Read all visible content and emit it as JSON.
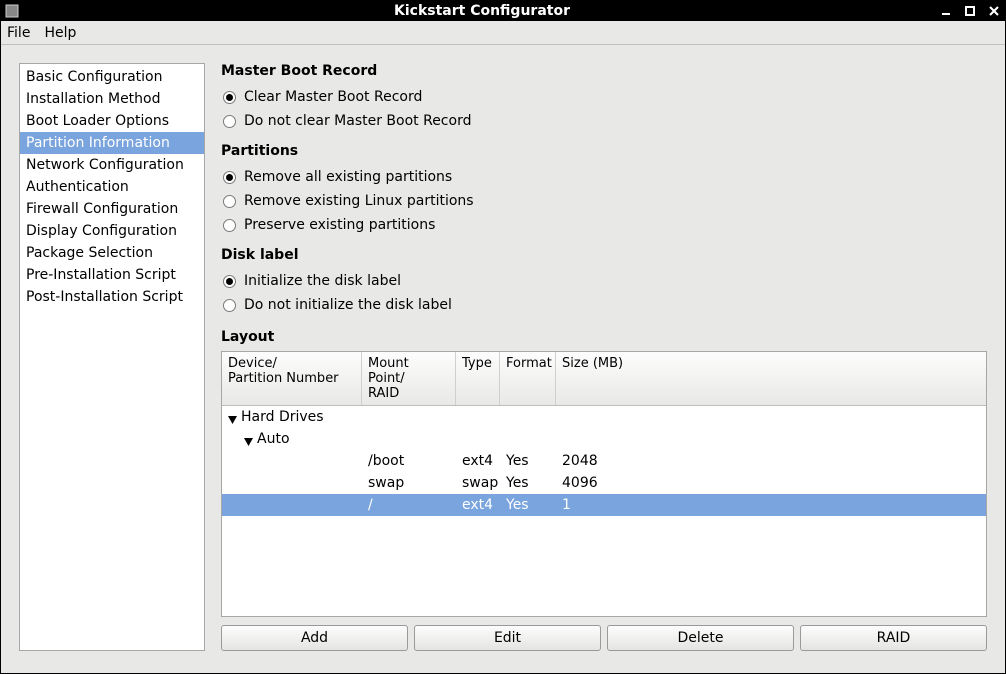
{
  "window": {
    "title": "Kickstart Configurator"
  },
  "menubar": {
    "file": "File",
    "help": "Help"
  },
  "sidebar": {
    "items": [
      {
        "label": "Basic Configuration",
        "selected": false
      },
      {
        "label": "Installation Method",
        "selected": false
      },
      {
        "label": "Boot Loader Options",
        "selected": false
      },
      {
        "label": "Partition Information",
        "selected": true
      },
      {
        "label": "Network Configuration",
        "selected": false
      },
      {
        "label": "Authentication",
        "selected": false
      },
      {
        "label": "Firewall Configuration",
        "selected": false
      },
      {
        "label": "Display Configuration",
        "selected": false
      },
      {
        "label": "Package Selection",
        "selected": false
      },
      {
        "label": "Pre-Installation Script",
        "selected": false
      },
      {
        "label": "Post-Installation Script",
        "selected": false
      }
    ]
  },
  "mbr": {
    "title": "Master Boot Record",
    "clear": "Clear Master Boot Record",
    "noclear": "Do not clear Master Boot Record",
    "selected": "clear"
  },
  "partitions": {
    "title": "Partitions",
    "remove_all": "Remove all existing partitions",
    "remove_linux": "Remove existing Linux partitions",
    "preserve": "Preserve existing partitions",
    "selected": "remove_all"
  },
  "disklabel": {
    "title": "Disk label",
    "init": "Initialize the disk label",
    "noinit": "Do not initialize the disk label",
    "selected": "init"
  },
  "layout": {
    "title": "Layout",
    "columns": {
      "device": "Device/\nPartition Number",
      "mount": "Mount Point/\nRAID",
      "type": "Type",
      "format": "Format",
      "size": "Size (MB)"
    },
    "tree": {
      "root_label": "Hard Drives",
      "child_label": "Auto",
      "rows": [
        {
          "mount": "/boot",
          "type": "ext4",
          "format": "Yes",
          "size": "2048",
          "selected": false
        },
        {
          "mount": "swap",
          "type": "swap",
          "format": "Yes",
          "size": "4096",
          "selected": false
        },
        {
          "mount": "/",
          "type": "ext4",
          "format": "Yes",
          "size": "1",
          "selected": true
        }
      ]
    },
    "buttons": {
      "add": "Add",
      "edit": "Edit",
      "delete": "Delete",
      "raid": "RAID"
    }
  }
}
